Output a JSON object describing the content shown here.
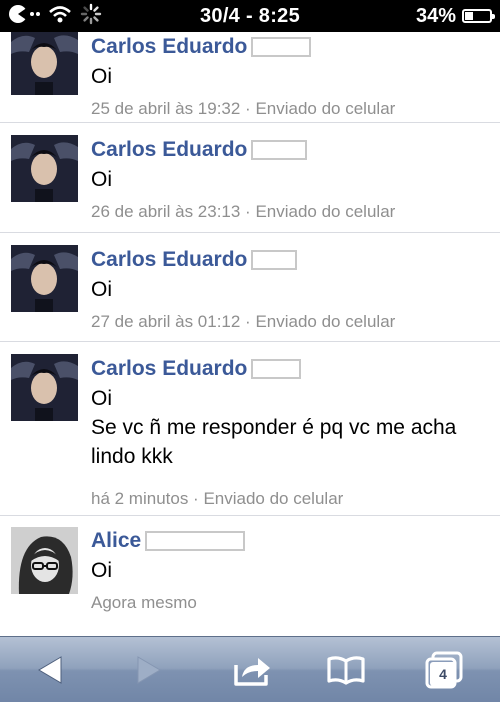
{
  "status_bar": {
    "time": "30/4 - 8:25",
    "battery_percent": "34%",
    "battery_level": 0.34
  },
  "messages": [
    {
      "sender": "Carlos Eduardo",
      "lines": [
        "Oi"
      ],
      "timestamp": "25 de abril às 19:32 · Enviado do celular"
    },
    {
      "sender": "Carlos Eduardo",
      "lines": [
        "Oi"
      ],
      "timestamp": "26 de abril às 23:13 · Enviado do celular"
    },
    {
      "sender": "Carlos Eduardo",
      "lines": [
        "Oi"
      ],
      "timestamp": "27 de abril às 01:12 · Enviado do celular"
    },
    {
      "sender": "Carlos Eduardo",
      "lines": [
        "Oi",
        "Se vc ñ me responder é pq vc me acha lindo kkk"
      ],
      "timestamp": "há 2 minutos · Enviado do celular"
    },
    {
      "sender": "Alice",
      "lines": [
        "Oi"
      ],
      "timestamp": "Agora mesmo"
    }
  ],
  "toolbar": {
    "tab_count": "4",
    "icons": [
      "back-arrow-icon",
      "forward-arrow-icon",
      "share-icon",
      "bookmarks-icon",
      "tabs-icon"
    ]
  },
  "colors": {
    "sender_name": "#3b5998",
    "meta_text": "#8f8f8f",
    "toolbar_top": "#b4c1d4",
    "toolbar_bottom": "#7186a7"
  }
}
